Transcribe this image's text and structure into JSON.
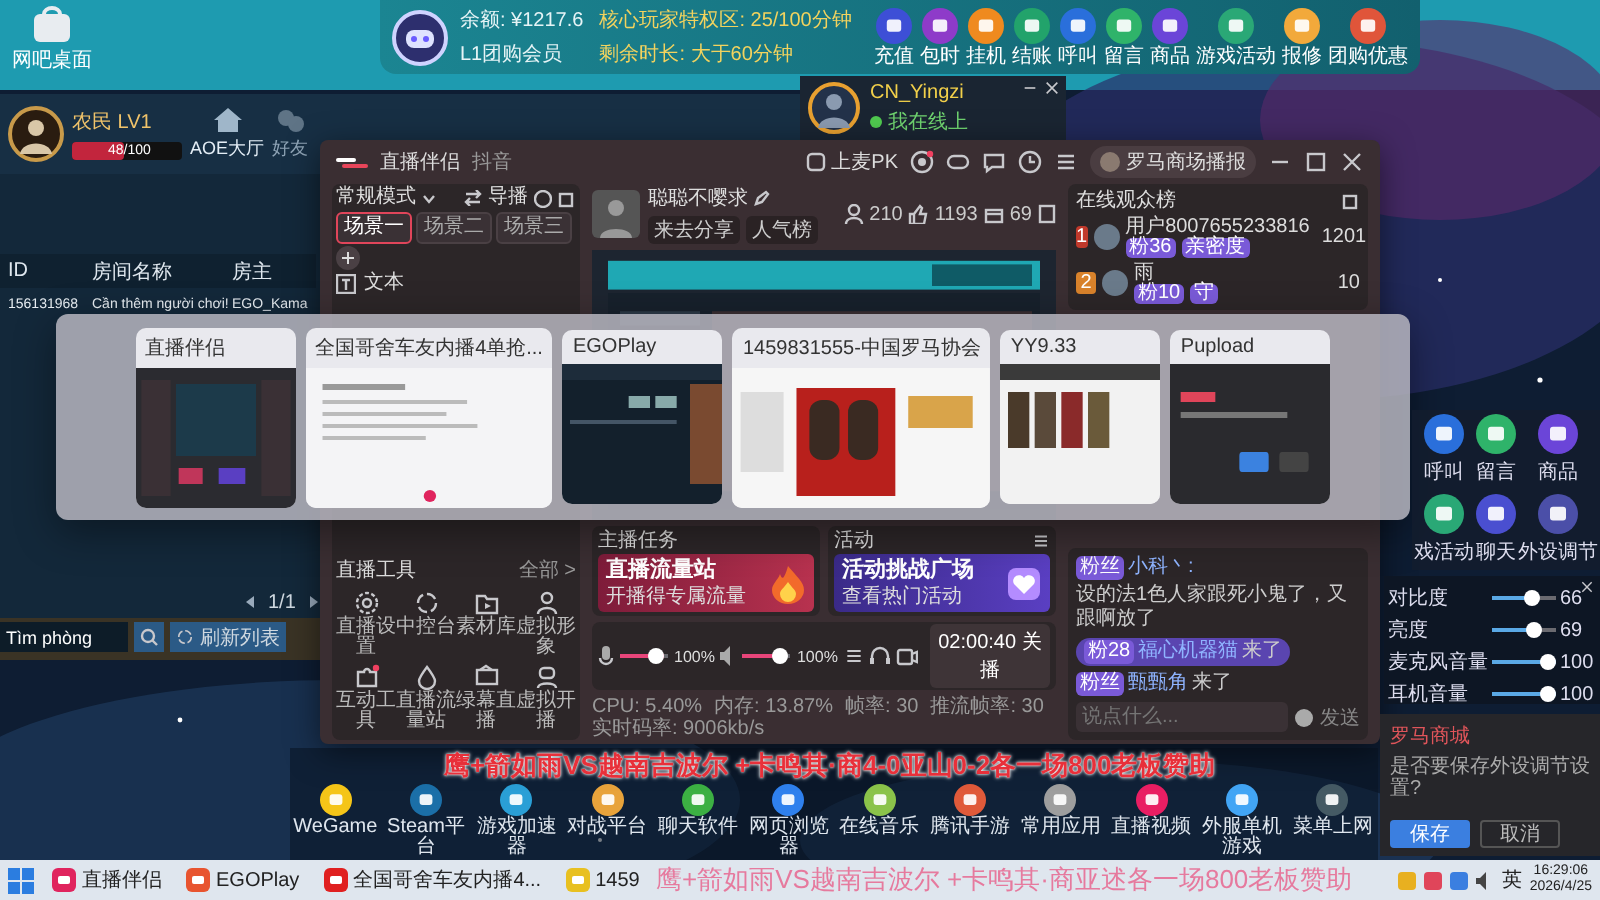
{
  "desktop_shortcut": {
    "label": "网吧桌面"
  },
  "member_bar": {
    "balance": "余额: ¥1217.6",
    "privilege": "核心玩家特权区: 25/100分钟",
    "membership": "L1团购会员",
    "remaining": "剩余时长: 大于60分钟",
    "actions": [
      {
        "label": "充值",
        "color": "#3d4fd6"
      },
      {
        "label": "包时",
        "color": "#8e3bc9"
      },
      {
        "label": "挂机",
        "color": "#ef8a1f"
      },
      {
        "label": "结账",
        "color": "#22a36b"
      },
      {
        "label": "呼叫",
        "color": "#2a6fdb"
      },
      {
        "label": "留言",
        "color": "#2fb36a"
      },
      {
        "label": "商品",
        "color": "#6b45d8"
      },
      {
        "label": "游戏活动",
        "color": "#2aa876"
      },
      {
        "label": "报修",
        "color": "#f2a93b"
      },
      {
        "label": "团购优惠",
        "color": "#e0553a"
      }
    ]
  },
  "lobby": {
    "player": "农民 LV1",
    "xp_bar": {
      "level": 0.48,
      "reading": "48/100"
    },
    "nav": [
      {
        "label": "AOE大厅",
        "selected": true
      },
      {
        "label": "好友",
        "selected": false
      }
    ],
    "table": {
      "columns": [
        "ID",
        "房间名称",
        "房主"
      ],
      "rows": [
        [
          "156131968",
          "Cần thêm người chơi!",
          "EGO_Kama"
        ]
      ]
    },
    "pager": "1/1",
    "search": {
      "value": "Tìm phòng"
    },
    "refresh": "刷新列表"
  },
  "friend_card": {
    "name": "CN_Yingzi",
    "status": "我在线上"
  },
  "stream": {
    "title": "直播伴侣",
    "subtitle": "抖音",
    "pk": "上麦PK",
    "account": "罗马商场播报",
    "mode": "常规模式",
    "director": "导播",
    "scenes": [
      {
        "label": "场景一",
        "selected": true
      },
      {
        "label": "场景二",
        "selected": false
      },
      {
        "label": "场景三",
        "selected": false
      }
    ],
    "source": "文本",
    "streamer": {
      "name": "聪聪不嘤求",
      "tags": [
        "来去分享",
        "人气榜"
      ]
    },
    "stats": [
      "210",
      "1193",
      "69"
    ],
    "audience": {
      "title": "在线观众榜",
      "rows": [
        {
          "rank": "1",
          "name": "用户8007655233816",
          "badges": [
            "粉36",
            "亲密度"
          ],
          "score": "1201"
        },
        {
          "rank": "2",
          "name": "雨",
          "badges": [
            "粉10",
            "守"
          ],
          "score": "10"
        }
      ]
    },
    "tools": {
      "title": "直播工具",
      "more": "全部 >",
      "items": [
        "直播设置",
        "中控台",
        "素材库",
        "虚拟形象",
        "互动工具",
        "直播流量站",
        "绿幕直播",
        "虚拟开播"
      ]
    },
    "task": {
      "title": "主播任务",
      "card_title": "直播流量站",
      "card_subtitle": "开播得专属流量"
    },
    "activity": {
      "title": "活动",
      "card_title": "活动挑战广场",
      "card_subtitle": "查看热门活动"
    },
    "audio": [
      {
        "kind": "mic",
        "level": 0.9,
        "reading": "100%"
      },
      {
        "kind": "speaker",
        "level": 0.9,
        "reading": "100%"
      }
    ],
    "end_button": "02:00:40 关播",
    "status": [
      "CPU: 5.40%",
      "内存: 13.87%",
      "帧率: 30",
      "推流帧率: 30",
      "实时码率: 9006kb/s"
    ],
    "chat": [
      {
        "badge": "粉丝",
        "user": "小科丶:",
        "text": "设的法1色人家跟死小鬼了，又跟啊放了",
        "highlight": false
      },
      {
        "badge": "粉28",
        "user": "福心机器猫",
        "text": "来了",
        "highlight": true
      },
      {
        "badge": "粉丝",
        "user": "甄甄角",
        "text": "来了",
        "highlight": false
      }
    ],
    "chat_input": {
      "placeholder": "说点什么...",
      "send": "发送"
    }
  },
  "switcher": {
    "windows": [
      {
        "title": "直播伴侣",
        "kind": "studio"
      },
      {
        "title": "全国哥舍车友内播4单抢...",
        "kind": "document"
      },
      {
        "title": "EGOPlay",
        "kind": "game"
      },
      {
        "title": "1459831555-中国罗马协会",
        "kind": "web"
      },
      {
        "title": "YY9.33",
        "kind": "video"
      },
      {
        "title": "Pupload",
        "kind": "dialog"
      }
    ]
  },
  "quick_actions": [
    {
      "label": "呼叫",
      "color": "#2a6fdb"
    },
    {
      "label": "留言",
      "color": "#2fb36a"
    },
    {
      "label": "商品",
      "color": "#6b45d8"
    },
    {
      "label": "戏活动",
      "color": "#2aa876"
    },
    {
      "label": "聊天",
      "color": "#4a4fd0"
    },
    {
      "label": "外设调节",
      "color": "#4b4fa8"
    }
  ],
  "peripherals": {
    "sliders": [
      {
        "label": "对比度",
        "level": 0.66,
        "reading": "66"
      },
      {
        "label": "亮度",
        "level": 0.69,
        "reading": "69"
      },
      {
        "label": "麦克风音量",
        "level": 1,
        "reading": "100"
      },
      {
        "label": "耳机音量",
        "level": 1,
        "reading": "100"
      }
    ]
  },
  "save_dialog": {
    "title": "罗马商城",
    "message": "是否要保存外设调节设置?",
    "buttons": [
      "保存",
      "取消"
    ]
  },
  "desktop_icons": [
    {
      "label": "WeGame",
      "color": "#f5c518"
    },
    {
      "label": "Steam平台",
      "color": "#1b6fa8"
    },
    {
      "label": "游戏加速器",
      "color": "#2a9fd6"
    },
    {
      "label": "对战平台",
      "color": "#e8a33b"
    },
    {
      "label": "聊天软件",
      "color": "#3cb043"
    },
    {
      "label": "网页浏览器",
      "color": "#2f80ed"
    },
    {
      "label": "在线音乐",
      "color": "#8bc34a"
    },
    {
      "label": "腾讯手游",
      "color": "#e05a3a"
    },
    {
      "label": "常用应用",
      "color": "#9e9e9e"
    },
    {
      "label": "直播视频",
      "color": "#e91e63"
    },
    {
      "label": "外服单机游戏",
      "color": "#42a5f5"
    },
    {
      "label": "菜单上网",
      "color": "#455a64"
    }
  ],
  "overlay_text": "鹰+箭如雨VS越南吉波尔 +卡鸣其·商4-0亚山0-2各一场800老板赞助",
  "taskbar": {
    "apps": [
      {
        "label": "直播伴侣",
        "color": "#e0245e"
      },
      {
        "label": "EGOPlay",
        "color": "#e8542f"
      },
      {
        "label": "全国哥舍车友内播4...",
        "color": "#e02020"
      },
      {
        "label": "1459",
        "color": "#e8c020"
      }
    ],
    "ticker": "鹰+箭如雨VS越南吉波尔 +卡鸣其·商亚述各一场800老板赞助",
    "ime": "英",
    "time": "16:29:06",
    "date": "2026/4/25"
  }
}
